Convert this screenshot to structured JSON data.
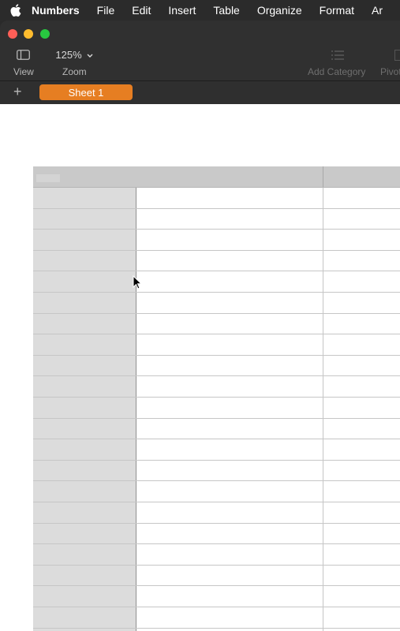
{
  "menubar": {
    "app_name": "Numbers",
    "items": [
      "File",
      "Edit",
      "Insert",
      "Table",
      "Organize",
      "Format",
      "Ar"
    ]
  },
  "toolbar": {
    "view_label": "View",
    "zoom_value": "125%",
    "zoom_label": "Zoom",
    "add_category_label": "Add Category",
    "pivot_label": "Pivot"
  },
  "sheets": {
    "add_label": "+",
    "tabs": [
      {
        "label": "Sheet 1",
        "selected": true
      }
    ]
  },
  "table": {
    "row_count": 21,
    "rows": []
  },
  "colors": {
    "accent": "#e67e22",
    "menubar": "#2b2b2b",
    "chrome": "#303030",
    "header_band": "#c9c9c9",
    "row_header": "#dcdcdc",
    "close": "#fe5f57",
    "minimize": "#febc2e",
    "maximize": "#28c840"
  },
  "icons": {
    "apple": "apple-icon",
    "sidebar": "sidebar-toggle-icon",
    "chevron": "chevron-down-icon",
    "category": "category-list-icon",
    "cursor": "mouse-pointer-icon"
  }
}
